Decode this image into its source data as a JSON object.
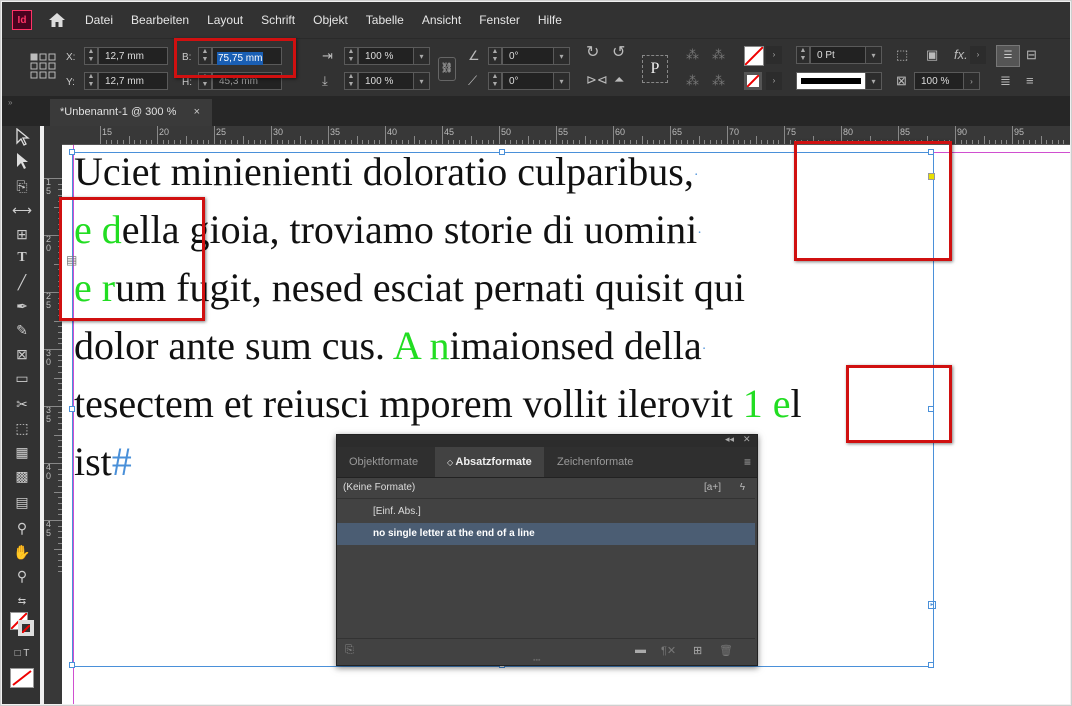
{
  "menu": {
    "app_icon": "Id",
    "items": [
      "Datei",
      "Bearbeiten",
      "Layout",
      "Schrift",
      "Objekt",
      "Tabelle",
      "Ansicht",
      "Fenster",
      "Hilfe"
    ]
  },
  "control": {
    "x_label": "X:",
    "x_value": "12,7 mm",
    "y_label": "Y:",
    "y_value": "12,7 mm",
    "w_label": "B:",
    "w_value": "75,75 mm",
    "h_label": "H:",
    "h_value": "45,3 mm",
    "scale_x": "100 %",
    "scale_y": "100 %",
    "rotate": "0°",
    "shear": "0°",
    "stroke_weight": "0 Pt",
    "opacity": "100 %",
    "p_label": "P",
    "fx_label": "fx."
  },
  "tab": {
    "title": "*Unbenannt-1 @ 300 %",
    "close": "×"
  },
  "ruler": {
    "h_labels": [
      "15",
      "20",
      "25",
      "30",
      "35",
      "40",
      "45",
      "50",
      "55",
      "60",
      "65",
      "70",
      "75",
      "80",
      "85",
      "90",
      "95"
    ],
    "v_labels": [
      "1 5",
      "2 0",
      "2 5",
      "3 0",
      "3 5",
      "4 0",
      "4 5"
    ]
  },
  "text": {
    "line1": "Uciet minienienti doloratio culparibus,",
    "line2a_green": "e d",
    "line2b": "ella gioia, troviamo storie di uomini",
    "line3a_green": "e r",
    "line3b": "um fugit, nesed esciat pernati quisit qui",
    "line4a": "dolor ante sum cus. ",
    "line4b_green": "A n",
    "line4c": "imaionsed della",
    "line5a": "tesectem et reiusci mporem vollit ilerovit ",
    "line5b_green": "1 e",
    "line5c": "l",
    "line6": "ist",
    "end_mark": "#"
  },
  "panel": {
    "tabs": [
      "Objektformate",
      "Absatzformate",
      "Zeichenformate"
    ],
    "active_tab": "Absatzformate",
    "root_item": "(Keine Formate)",
    "items": [
      "[Einf. Abs.]",
      "no single letter at the end of a line"
    ],
    "selected_item": "no single letter at the end of a line",
    "new_from_selection": "[a+]"
  },
  "colors": {
    "highlight": "#d01010",
    "green_text": "#22dd22",
    "frame_blue": "#4a90d9"
  }
}
